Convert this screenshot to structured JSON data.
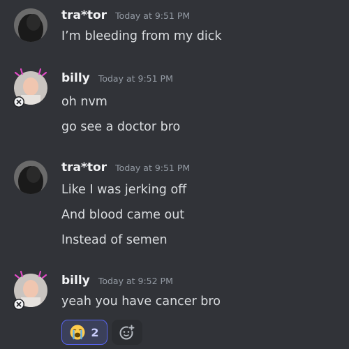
{
  "messages": [
    {
      "username": "tra*tor",
      "timestamp": "Today at 9:51 PM",
      "lines": [
        "I’m bleeding from my dick"
      ]
    },
    {
      "username": "billy",
      "timestamp": "Today at 9:51 PM",
      "lines": [
        "oh nvm",
        "go see a doctor bro"
      ]
    },
    {
      "username": "tra*tor",
      "timestamp": "Today at 9:51 PM",
      "lines": [
        "Like I was jerking off",
        "And blood came out",
        "Instead of semen"
      ]
    },
    {
      "username": "billy",
      "timestamp": "Today at 9:52 PM",
      "lines": [
        "yeah you have cancer bro"
      ]
    }
  ],
  "reaction": {
    "emoji": "loudly-crying-face-icon",
    "count": "2"
  },
  "colors": {
    "background": "#313338",
    "reaction_active_border": "#5865f2",
    "reaction_active_bg": "#3b405a"
  }
}
